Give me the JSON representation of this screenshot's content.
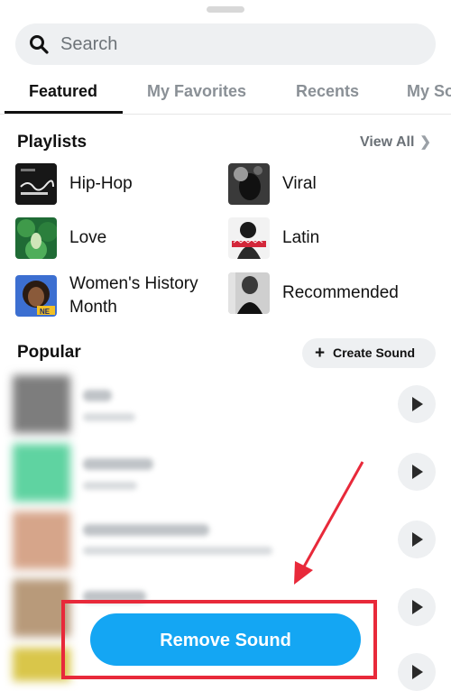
{
  "search": {
    "placeholder": "Search",
    "icon": "search-icon"
  },
  "tabs": [
    {
      "label": "Featured",
      "active": true
    },
    {
      "label": "My Favorites",
      "active": false
    },
    {
      "label": "Recents",
      "active": false
    },
    {
      "label": "My So",
      "active": false
    }
  ],
  "playlists": {
    "title": "Playlists",
    "view_all": "View All",
    "items": [
      {
        "label": "Hip-Hop"
      },
      {
        "label": "Viral"
      },
      {
        "label": "Love"
      },
      {
        "label": "Latin"
      },
      {
        "label": "Women's History Month"
      },
      {
        "label": "Recommended"
      }
    ]
  },
  "popular": {
    "title": "Popular",
    "create_button": "Create Sound",
    "create_icon": "plus-icon"
  },
  "remove_sound": {
    "label": "Remove Sound"
  },
  "colors": {
    "accent": "#14a6f3",
    "annotation": "#e8293a"
  }
}
